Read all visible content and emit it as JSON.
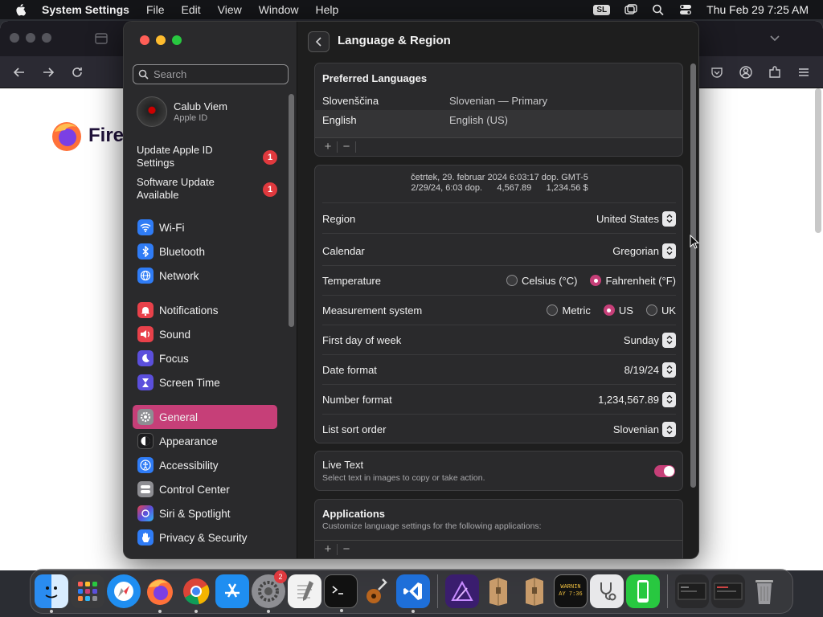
{
  "menubar": {
    "app_name": "System Settings",
    "menus": [
      "File",
      "Edit",
      "View",
      "Window",
      "Help"
    ],
    "input_source": "SL",
    "datetime": "Thu Feb 29  7:25 AM"
  },
  "firefox": {
    "brand_word": "Firef"
  },
  "sidebar": {
    "search_placeholder": "Search",
    "profile": {
      "name": "Calub Viem",
      "subtitle": "Apple ID"
    },
    "notices": [
      {
        "label": "Update Apple ID Settings",
        "badge": "1"
      },
      {
        "label": "Software Update Available",
        "badge": "1"
      }
    ],
    "items": [
      {
        "label": "Wi-Fi",
        "icon": "wifi-icon"
      },
      {
        "label": "Bluetooth",
        "icon": "bluetooth-icon"
      },
      {
        "label": "Network",
        "icon": "globe-icon"
      },
      {
        "label": "Notifications",
        "icon": "bell-icon"
      },
      {
        "label": "Sound",
        "icon": "speaker-icon"
      },
      {
        "label": "Focus",
        "icon": "moon-icon"
      },
      {
        "label": "Screen Time",
        "icon": "hourglass-icon"
      },
      {
        "label": "General",
        "icon": "gear-icon"
      },
      {
        "label": "Appearance",
        "icon": "appearance-icon"
      },
      {
        "label": "Accessibility",
        "icon": "accessibility-icon"
      },
      {
        "label": "Control Center",
        "icon": "control-center-icon"
      },
      {
        "label": "Siri & Spotlight",
        "icon": "siri-icon"
      },
      {
        "label": "Privacy & Security",
        "icon": "hand-icon"
      }
    ],
    "active": "General"
  },
  "main": {
    "title": "Language & Region",
    "preferred_languages": {
      "heading": "Preferred Languages",
      "rows": [
        {
          "name": "Slovenščina",
          "detail": "Slovenian — Primary"
        },
        {
          "name": "English",
          "detail": "English (US)"
        }
      ]
    },
    "format_preview": {
      "line1": "četrtek, 29. februar 2024 6:03:17 dop. GMT-5",
      "line2": "2/29/24, 6:03 dop.      4,567.89      1,234.56 $"
    },
    "settings": {
      "region": {
        "label": "Region",
        "value": "United States"
      },
      "calendar": {
        "label": "Calendar",
        "value": "Gregorian"
      },
      "temperature": {
        "label": "Temperature",
        "options": [
          "Celsius (°C)",
          "Fahrenheit (°F)"
        ],
        "selected": "Fahrenheit (°F)"
      },
      "measurement": {
        "label": "Measurement system",
        "options": [
          "Metric",
          "US",
          "UK"
        ],
        "selected": "US"
      },
      "first_day": {
        "label": "First day of week",
        "value": "Sunday"
      },
      "date_format": {
        "label": "Date format",
        "value": "8/19/24"
      },
      "number_format": {
        "label": "Number format",
        "value": "1,234,567.89"
      },
      "sort_order": {
        "label": "List sort order",
        "value": "Slovenian"
      }
    },
    "live_text": {
      "title": "Live Text",
      "subtitle": "Select text in images to copy or take action.",
      "enabled": true
    },
    "applications": {
      "title": "Applications",
      "subtitle": "Customize language settings for the following applications:"
    }
  },
  "dock": {
    "apps": [
      "Finder",
      "Launchpad",
      "Safari",
      "Firefox",
      "Chrome",
      "App Store",
      "System Settings",
      "TextEdit",
      "Terminal",
      "Instruments",
      "VS Code",
      "Affinity",
      "Archive",
      "Archive",
      "Console",
      "Preview",
      "Phone"
    ],
    "settings_badge": "2",
    "console_text": "WARNIN\nAY 7:36"
  },
  "colors": {
    "accent": "#c63f78",
    "badge": "#e0393e"
  }
}
